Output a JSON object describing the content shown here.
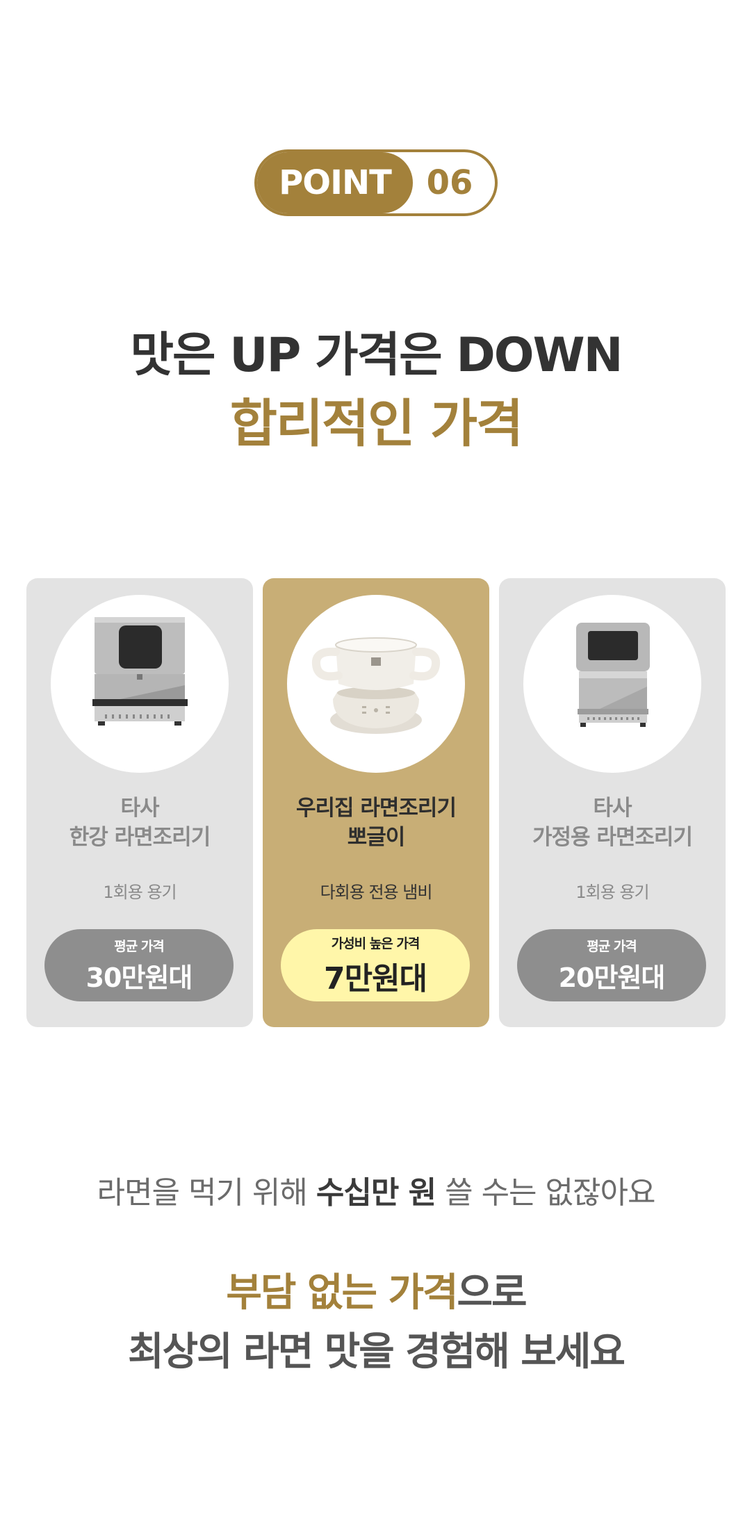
{
  "badge": {
    "point_label": "POINT",
    "number": "06"
  },
  "headline": {
    "line1": "맛은 UP 가격은 DOWN",
    "line2": "합리적인 가격"
  },
  "cards": [
    {
      "title_line1": "타사",
      "title_line2": "한강 라면조리기",
      "container": "1회용 용기",
      "price_label": "평균 가격",
      "price": "30만원대",
      "image": "hangang-ramen-machine",
      "highlighted": false
    },
    {
      "title_line1": "우리집 라면조리기",
      "title_line2": "뽀글이",
      "container": "다회용 전용 냄비",
      "price_label": "가성비 높은 가격",
      "price": "7만원대",
      "image": "ppogeuli-pot",
      "highlighted": true
    },
    {
      "title_line1": "타사",
      "title_line2": "가정용 라면조리기",
      "container": "1회용 용기",
      "price_label": "평균 가격",
      "price": "20만원대",
      "image": "home-ramen-machine",
      "highlighted": false
    }
  ],
  "bottom": {
    "line_pre": "라면을 먹기 위해 ",
    "line_bold": "수십만 원",
    "line_post": " 쓸 수는 없잖아요",
    "closing1_gold": "부담 없는 가격",
    "closing1_rest": "으로",
    "closing2": "최상의 라면 맛을 경험해 보세요"
  },
  "colors": {
    "accent_gold": "#a3813b",
    "card_gold": "#c8ae76",
    "card_gray": "#e3e3e3",
    "pill_gray": "#8e8e8e",
    "pill_yellow": "#fff6a9"
  }
}
